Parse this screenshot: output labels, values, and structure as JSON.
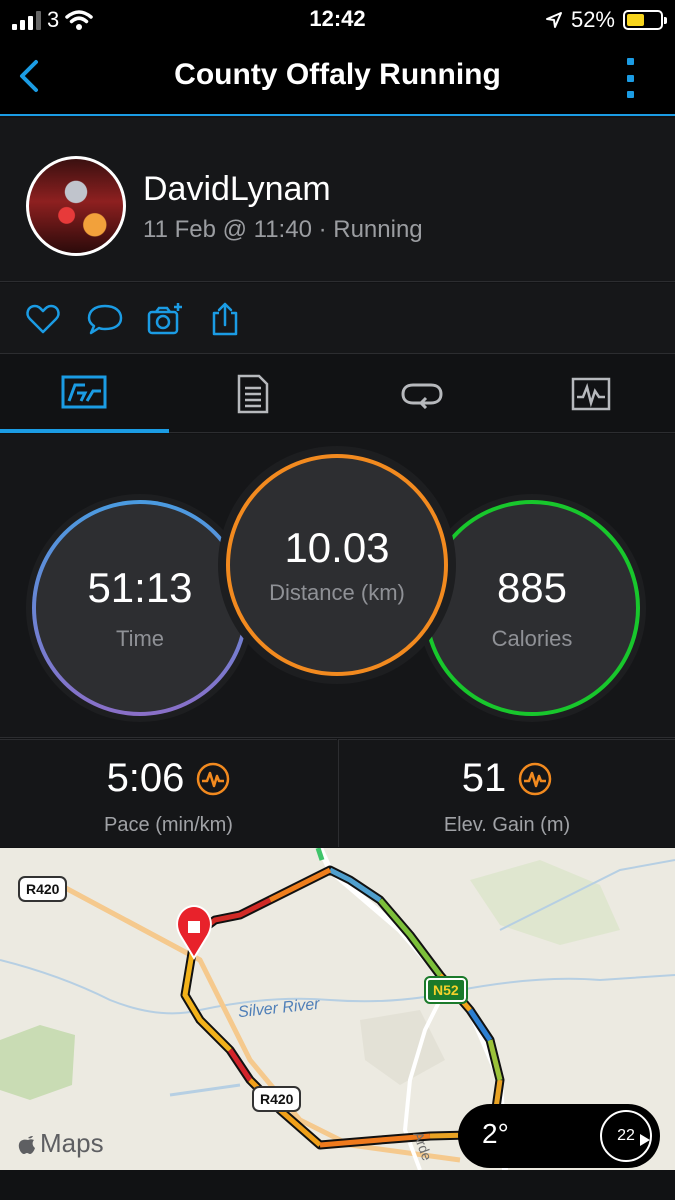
{
  "status_bar": {
    "carrier": "3",
    "time": "12:42",
    "battery_text": "52%",
    "battery_level": 0.52
  },
  "nav": {
    "title": "County Offaly Running"
  },
  "activity": {
    "user_name": "DavidLynam",
    "meta": "11 Feb @ 11:40 · Running"
  },
  "tabs": [
    {
      "name": "overview",
      "icon": "overview-icon",
      "active": true
    },
    {
      "name": "details",
      "icon": "document-icon",
      "active": false
    },
    {
      "name": "laps",
      "icon": "laps-icon",
      "active": false
    },
    {
      "name": "charts",
      "icon": "chart-icon",
      "active": false
    }
  ],
  "stats": {
    "time": {
      "value": "51:13",
      "label": "Time"
    },
    "distance": {
      "value": "10.03",
      "label": "Distance (km)"
    },
    "calories": {
      "value": "885",
      "label": "Calories"
    }
  },
  "metrics": {
    "pace": {
      "value": "5:06",
      "label": "Pace (min/km)"
    },
    "elevation": {
      "value": "51",
      "label": "Elev. Gain (m)"
    }
  },
  "map": {
    "road_r420_top": "R420",
    "road_r420_bottom": "R420",
    "road_n52": "N52",
    "river": "Silver River",
    "road_partial": "Arde",
    "brand": "Maps",
    "temperature": "2°",
    "wind": "22"
  },
  "colors": {
    "accent": "#1b9ce4",
    "time_ring": "#6f88d8",
    "distance_ring": "#f28a1f",
    "calories_ring": "#18c72c",
    "chart_icon": "#f28a1f"
  }
}
